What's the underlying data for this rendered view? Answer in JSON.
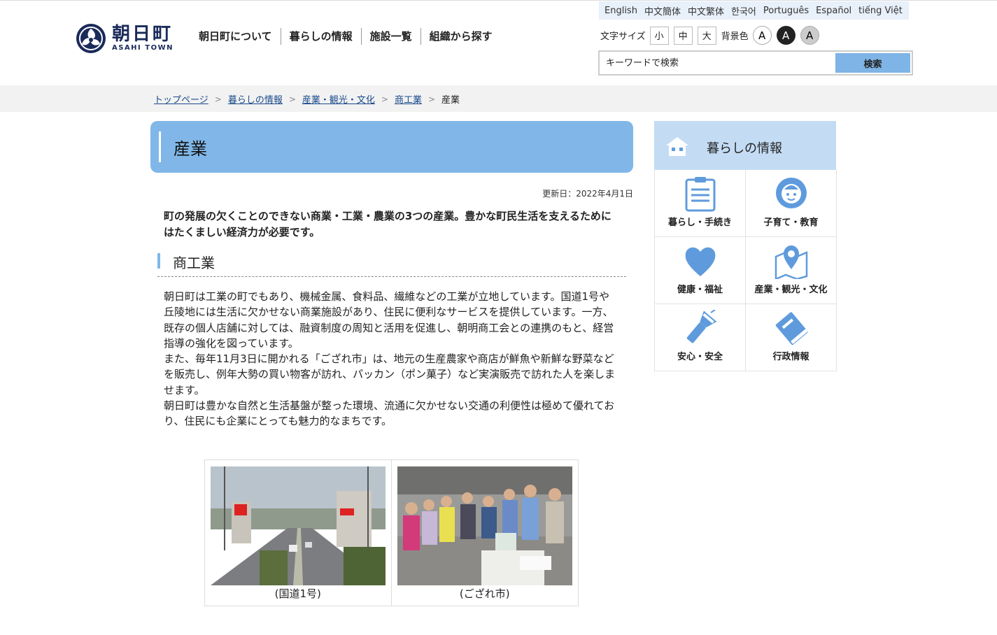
{
  "header": {
    "logo_jp": "朝日町",
    "logo_en": "ASAHI TOWN",
    "nav": [
      "朝日町について",
      "暮らしの情報",
      "施設一覧",
      "組織から探す"
    ],
    "languages": [
      "English",
      "中文簡体",
      "中文繁体",
      "한국어",
      "Português",
      "Español",
      "tiếng Việt"
    ],
    "font_size_label": "文字サイズ",
    "font_sizes": [
      "小",
      "中",
      "大"
    ],
    "bg_color_label": "背景色",
    "bg_options": [
      "A",
      "A",
      "A"
    ],
    "search_placeholder": "キーワードで検索",
    "search_button": "検索"
  },
  "breadcrumb": {
    "items": [
      "トップページ",
      "暮らしの情報",
      "産業・観光・文化",
      "商工業"
    ],
    "current": "産業"
  },
  "main": {
    "title": "産業",
    "updated": "更新日：2022年4月1日",
    "lead": "町の発展の欠くことのできない商業・工業・農業の3つの産業。豊かな町民生活を支えるためにはたくましい経済力が必要です。",
    "section_title": "商工業",
    "paragraphs": [
      "朝日町は工業の町でもあり、機械金属、食料品、繊維などの工業が立地しています。国道1号や丘陵地には生活に欠かせない商業施設があり、住民に便利なサービスを提供しています。一方、既存の個人店舗に対しては、融資制度の周知と活用を促進し、朝明商工会との連携のもと、経営指導の強化を図っています。",
      "また、毎年11月3日に開かれる「ござれ市」は、地元の生産農家や商店が鮮魚や新鮮な野菜などを販売し、例年大勢の買い物客が訪れ、パッカン（ポン菓子）など実演販売で訪れた人を楽しませます。",
      "朝日町は豊かな自然と生活基盤が整った環境、流通に欠かせない交通の利便性は極めて優れており、住民にも企業にとっても魅力的なまちです。"
    ],
    "photos": [
      {
        "caption": "(国道1号)"
      },
      {
        "caption": "(ござれ市)"
      }
    ]
  },
  "side": {
    "title": "暮らしの情報",
    "items": [
      {
        "label": "暮らし・手続き",
        "icon": "clipboard-icon"
      },
      {
        "label": "子育て・教育",
        "icon": "baby-icon"
      },
      {
        "label": "健康・福祉",
        "icon": "heart-icon"
      },
      {
        "label": "産業・観光・文化",
        "icon": "map-pin-icon"
      },
      {
        "label": "安心・安全",
        "icon": "flashlight-icon"
      },
      {
        "label": "行政情報",
        "icon": "book-icon"
      }
    ]
  },
  "colors": {
    "accent": "#80b7e8",
    "side_head": "#c3dcf4",
    "lang_bar": "#e8f0fa",
    "icon": "#5f9bdc"
  }
}
